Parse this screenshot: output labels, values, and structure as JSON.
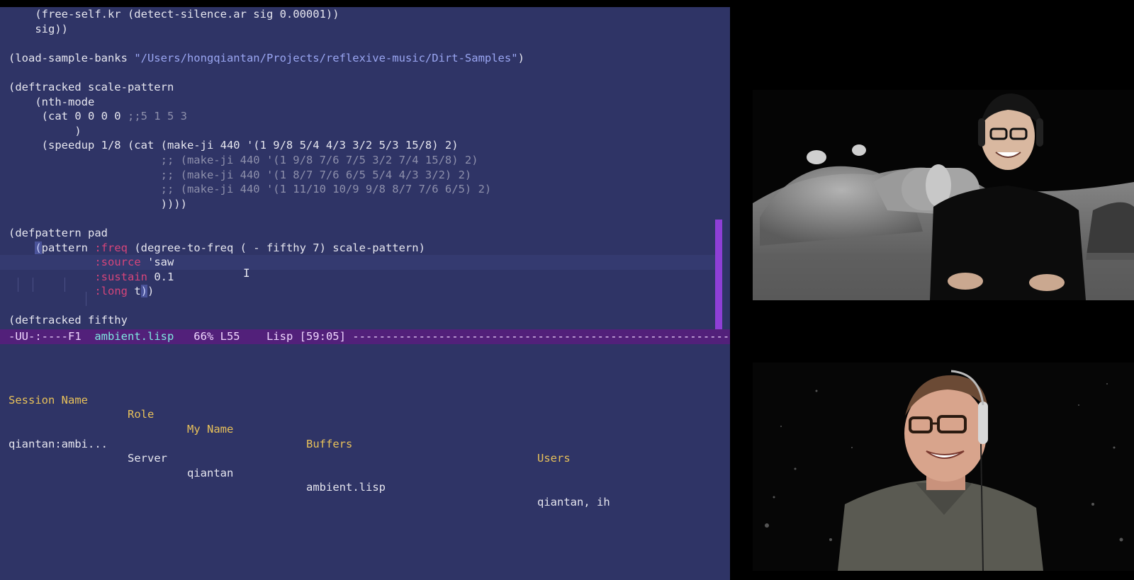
{
  "editor": {
    "lines": [
      {
        "parts": [
          {
            "t": "    (free-self.kr (detect-silence.ar sig 0.00001))"
          }
        ]
      },
      {
        "parts": [
          {
            "t": "    sig))"
          }
        ]
      },
      {
        "parts": [
          {
            "t": ""
          }
        ]
      },
      {
        "parts": [
          {
            "t": "(load-sample-banks "
          },
          {
            "t": "\"/Users/hongqiantan/Projects/reflexive-music/Dirt-Samples\"",
            "c": "str"
          },
          {
            "t": ")"
          }
        ]
      },
      {
        "parts": [
          {
            "t": ""
          }
        ]
      },
      {
        "parts": [
          {
            "t": "(deftracked scale-pattern"
          }
        ]
      },
      {
        "parts": [
          {
            "t": "    (nth-mode"
          }
        ]
      },
      {
        "parts": [
          {
            "t": "     (cat 0 0 0 0 "
          },
          {
            "t": ";;5 1 5 3",
            "c": "cm"
          }
        ]
      },
      {
        "parts": [
          {
            "t": "          )"
          }
        ]
      },
      {
        "parts": [
          {
            "t": "     (speedup 1/8 (cat (make-ji 440 '(1 9/8 5/4 4/3 3/2 5/3 15/8) 2)"
          }
        ]
      },
      {
        "parts": [
          {
            "t": "                       "
          },
          {
            "t": ";; (make-ji 440 '(1 9/8 7/6 7/5 3/2 7/4 15/8) 2)",
            "c": "cm"
          }
        ]
      },
      {
        "parts": [
          {
            "t": "                       "
          },
          {
            "t": ";; (make-ji 440 '(1 8/7 7/6 6/5 5/4 4/3 3/2) 2)",
            "c": "cm"
          }
        ]
      },
      {
        "parts": [
          {
            "t": "                       "
          },
          {
            "t": ";; (make-ji 440 '(1 11/10 10/9 9/8 8/7 7/6 6/5) 2)",
            "c": "cm"
          }
        ]
      },
      {
        "parts": [
          {
            "t": "                       ))))"
          }
        ]
      },
      {
        "parts": [
          {
            "t": ""
          }
        ]
      },
      {
        "parts": [
          {
            "t": "(defpattern pad"
          }
        ]
      },
      {
        "parts": [
          {
            "t": "    "
          },
          {
            "t": "(",
            "c": "cur-paren"
          },
          {
            "t": "pattern "
          },
          {
            "t": ":freq",
            "c": "kw"
          },
          {
            "t": " (degree-to-freq ( - fifthy 7) scale-pattern)"
          }
        ]
      },
      {
        "hl": true,
        "parts": [
          {
            "t": "             "
          },
          {
            "t": ":source",
            "c": "kw"
          },
          {
            "t": " 'saw"
          }
        ]
      },
      {
        "parts": [
          {
            "t": "             "
          },
          {
            "t": ":sustain",
            "c": "kw"
          },
          {
            "t": " 0.1"
          }
        ]
      },
      {
        "parts": [
          {
            "t": "             "
          },
          {
            "t": ":long",
            "c": "kw"
          },
          {
            "t": " t"
          },
          {
            "t": ")",
            "c": "cur-paren"
          },
          {
            "t": ")"
          }
        ]
      },
      {
        "parts": [
          {
            "t": ""
          }
        ]
      },
      {
        "parts": [
          {
            "t": "(deftracked fifthy"
          }
        ]
      }
    ]
  },
  "modeline": {
    "prefix": "-UU-:----F1  ",
    "buffer": "ambient.lisp",
    "rest": "   66% L55    Lisp [59:05] ---------------------------------------------------------------"
  },
  "sessions": {
    "headers": [
      "Session Name",
      "Role",
      "My Name",
      "Buffers",
      "Users"
    ],
    "rows": [
      [
        "qiantan:ambi...",
        "Server",
        "qiantan",
        "ambient.lisp",
        "qiantan, ih"
      ]
    ]
  },
  "colors": {
    "editor_bg": "#2f3466",
    "keyword": "#d6457a",
    "string": "#9aa6f2",
    "comment": "#8d8fab",
    "modeline_bg": "#52207a",
    "scrollbar": "#8e3fd6",
    "header": "#e8c15a"
  }
}
